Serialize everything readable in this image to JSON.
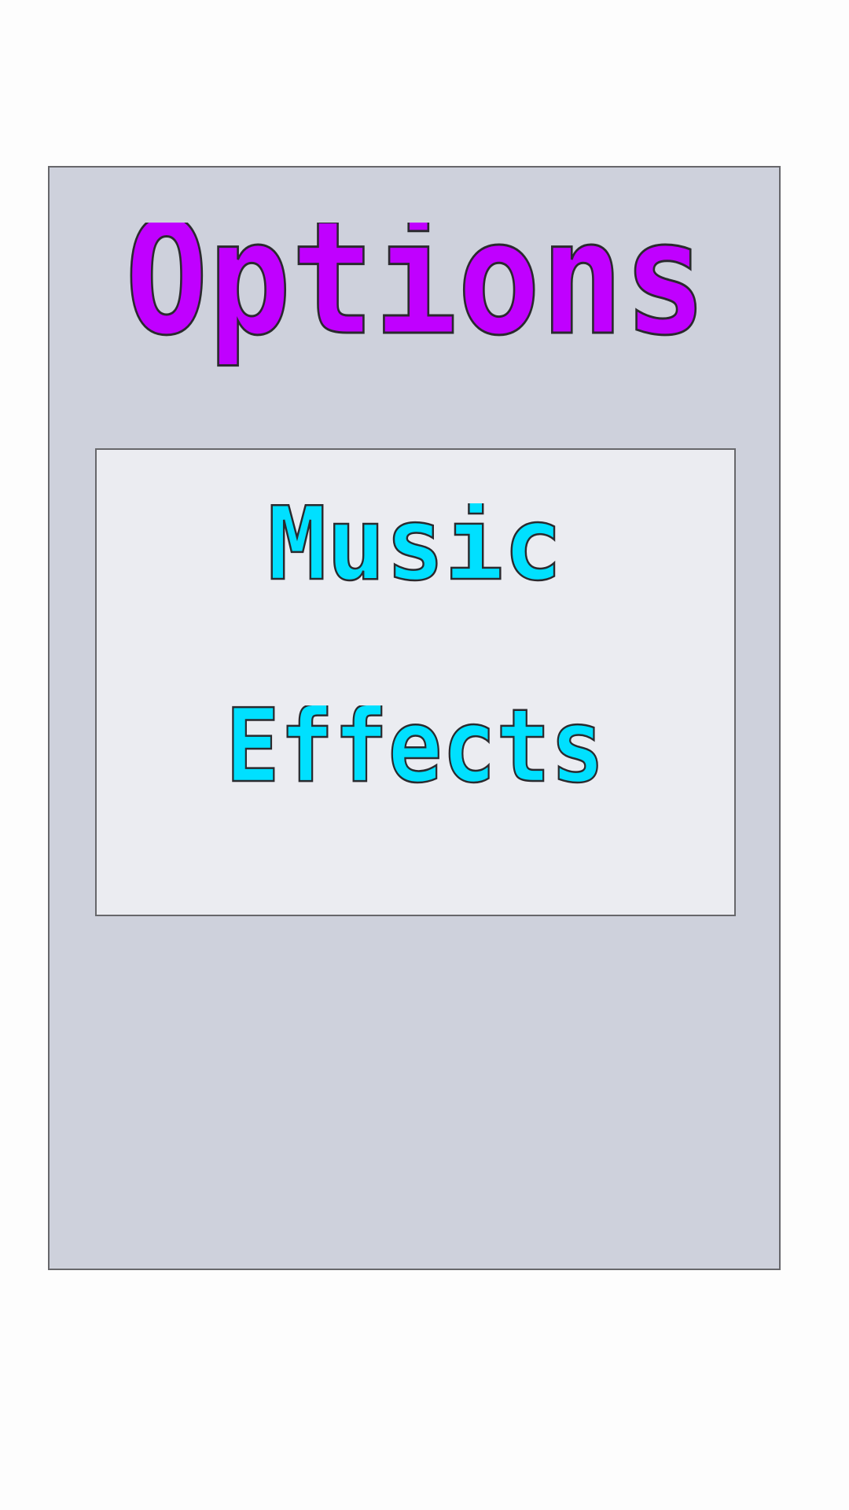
{
  "screen": {
    "title": "Options"
  },
  "menu": {
    "items": [
      {
        "id": "music",
        "label": "Music"
      },
      {
        "id": "effects",
        "label": "Effects"
      }
    ]
  },
  "colors": {
    "background": "#fdfdfd",
    "panel": "#ced1dc",
    "menu_box": "#ebecf1",
    "border": "#67676b",
    "title_fill": "#c000ff",
    "item_fill": "#00e0ff",
    "text_stroke": "#2a2a2e"
  }
}
